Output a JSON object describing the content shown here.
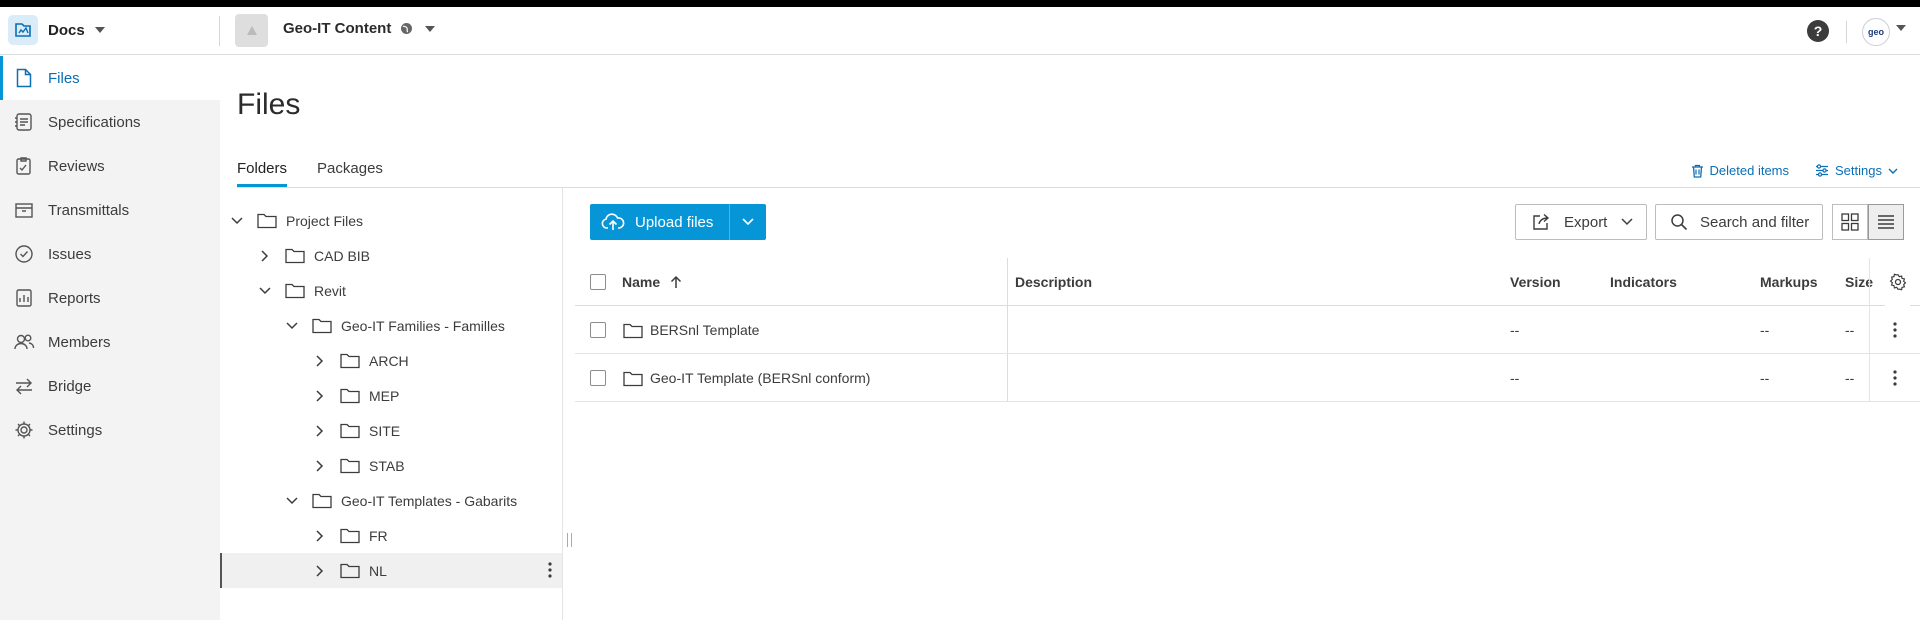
{
  "header": {
    "app_name": "Docs",
    "project_name": "Geo-IT Content",
    "help_label": "?",
    "avatar_text": "geo"
  },
  "sidebar": {
    "items": [
      {
        "label": "Files",
        "icon": "file-icon",
        "active": true
      },
      {
        "label": "Specifications",
        "icon": "specifications-icon"
      },
      {
        "label": "Reviews",
        "icon": "reviews-icon"
      },
      {
        "label": "Transmittals",
        "icon": "transmittals-icon"
      },
      {
        "label": "Issues",
        "icon": "issues-icon"
      },
      {
        "label": "Reports",
        "icon": "reports-icon"
      },
      {
        "label": "Members",
        "icon": "members-icon"
      },
      {
        "label": "Bridge",
        "icon": "bridge-icon"
      },
      {
        "label": "Settings",
        "icon": "settings-icon"
      }
    ]
  },
  "main": {
    "title": "Files",
    "tabs": [
      {
        "label": "Folders",
        "active": true
      },
      {
        "label": "Packages"
      }
    ],
    "deleted_items_label": "Deleted items",
    "settings_label": "Settings"
  },
  "tree": {
    "nodes": [
      {
        "label": "Project Files",
        "expanded": true
      },
      {
        "label": "CAD BIB",
        "expanded": false
      },
      {
        "label": "Revit",
        "expanded": true
      },
      {
        "label": "Geo-IT Families - Familles",
        "expanded": true
      },
      {
        "label": "ARCH",
        "expanded": false
      },
      {
        "label": "MEP",
        "expanded": false
      },
      {
        "label": "SITE",
        "expanded": false
      },
      {
        "label": "STAB",
        "expanded": false
      },
      {
        "label": "Geo-IT Templates - Gabarits",
        "expanded": true
      },
      {
        "label": "FR",
        "expanded": false
      },
      {
        "label": "NL",
        "expanded": false,
        "selected": true
      }
    ]
  },
  "toolbar": {
    "upload_label": "Upload files",
    "export_label": "Export",
    "search_label": "Search and filter"
  },
  "table": {
    "columns": {
      "name": "Name",
      "description": "Description",
      "version": "Version",
      "indicators": "Indicators",
      "markups": "Markups",
      "size": "Size"
    },
    "rows": [
      {
        "name": "BERSnl Template",
        "description": "",
        "version": "--",
        "markups": "--",
        "size": "--"
      },
      {
        "name": "Geo-IT Template (BERSnl conform)",
        "description": "",
        "version": "--",
        "markups": "--",
        "size": "--"
      }
    ]
  },
  "colors": {
    "accent": "#0696d7",
    "link": "#0a6fb5",
    "sidebar_bg": "#f3f3f3"
  }
}
